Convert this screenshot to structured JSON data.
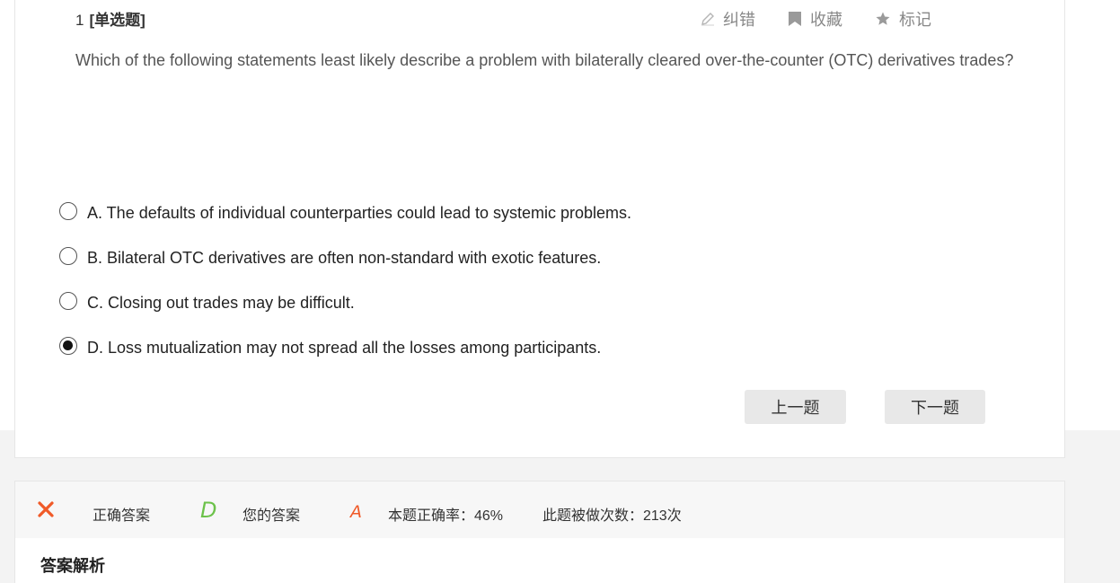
{
  "question": {
    "number": "1",
    "type_label": "[单选题]",
    "text": "Which of the following statements least likely describe a problem with bilaterally cleared over-the-counter (OTC) derivatives trades?"
  },
  "tools": {
    "report_label": "纠错",
    "favorite_label": "收藏",
    "mark_label": "标记",
    "icons": [
      "pencil-icon",
      "bookmark-icon",
      "star-icon"
    ]
  },
  "options": [
    {
      "label": "A. The defaults of individual counterparties could lead to systemic problems.",
      "selected": false
    },
    {
      "label": "B. Bilateral OTC derivatives are often non-standard with exotic features.",
      "selected": false
    },
    {
      "label": "C. Closing out trades may be difficult.",
      "selected": false
    },
    {
      "label": "D. Loss mutualization may not spread all the losses among participants.",
      "selected": true
    }
  ],
  "navigation": {
    "prev_label": "上一题",
    "next_label": "下一题"
  },
  "result": {
    "status_icon": "x-icon",
    "status_color": "#f05a28",
    "correct_answer_label": "正确答案",
    "correct_answer": "D",
    "correct_color": "#6cc24a",
    "your_answer_label": "您的答案",
    "your_answer": "A",
    "your_color": "#f05a28",
    "accuracy_text": "本题正确率：46%",
    "attempts_text": "此题被做次数：213次"
  },
  "analysis": {
    "title": "答案解析"
  }
}
